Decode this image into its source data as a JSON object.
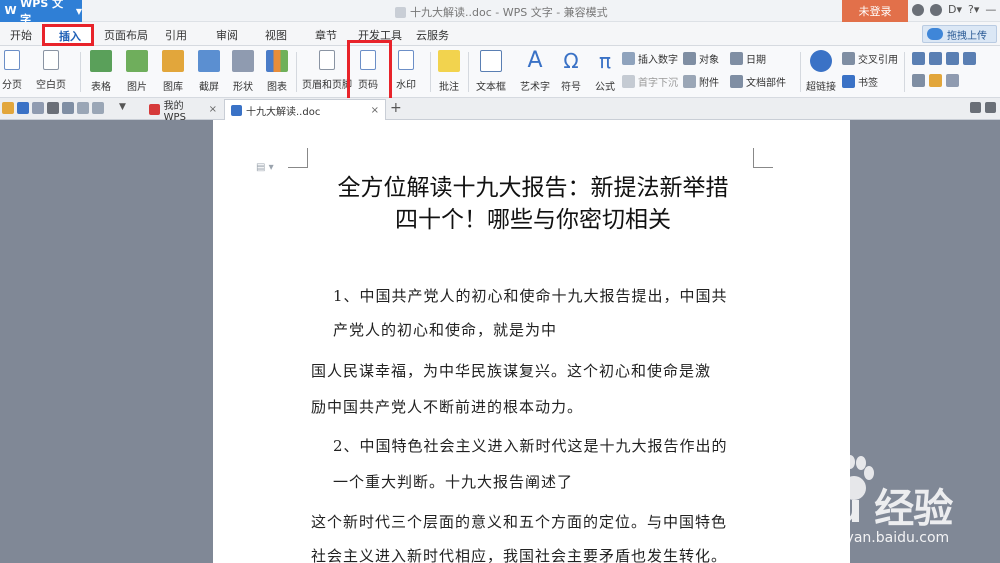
{
  "titlebar": {
    "app_name": "WPS 文字",
    "doc_title": "十九大解读..doc - WPS 文字 - 兼容模式",
    "login": "未登录"
  },
  "menu": {
    "tabs": [
      "开始",
      "插入",
      "页面布局",
      "引用",
      "审阅",
      "视图",
      "章节",
      "开发工具",
      "云服务"
    ],
    "active": "插入",
    "cloud_upload": "拖拽上传"
  },
  "ribbon": {
    "page_break": "分页",
    "blank_page": "空白页",
    "table": "表格",
    "picture": "图片",
    "gallery": "图库",
    "screenshot": "截屏",
    "shape": "形状",
    "chart": "图表",
    "header_footer": "页眉和页脚",
    "page_number": "页码",
    "watermark": "水印",
    "comment": "批注",
    "text_box": "文本框",
    "wordart": "艺术字",
    "symbol": "符号",
    "formula": "公式",
    "insert_number": "插入数字",
    "object": "对象",
    "date": "日期",
    "drop_cap": "首字下沉",
    "attachment": "附件",
    "doc_parts": "文档部件",
    "hyperlink": "超链接",
    "cross_ref": "交叉引用",
    "bookmark": "书签"
  },
  "doc_tabs": {
    "tab1": "我的WPS",
    "tab2": "十九大解读..doc"
  },
  "document": {
    "title_line1": "全方位解读十九大报告：新提法新举措",
    "title_line2": "四十个！哪些与你密切相关",
    "p1a": "1、中国共产党人的初心和使命十九大报告提出，中国共",
    "p1b": "产党人的初心和使命，就是为中",
    "p2a": "国人民谋幸福，为中华民族谋复兴。这个初心和使命是激",
    "p2b": "励中国共产党人不断前进的根本动力。",
    "p3a": "2、中国特色社会主义进入新时代这是十九大报告作出的",
    "p3b": "一个重大判断。十九大报告阐述了",
    "p4a": "这个新时代三个层面的意义和五个方面的定位。与中国特色",
    "p4b": "社会主义进入新时代相应，我国社会主要矛盾也发生转化。"
  },
  "watermark": {
    "logo": "Baidu 经验",
    "url": "jingyan.baidu.com"
  }
}
